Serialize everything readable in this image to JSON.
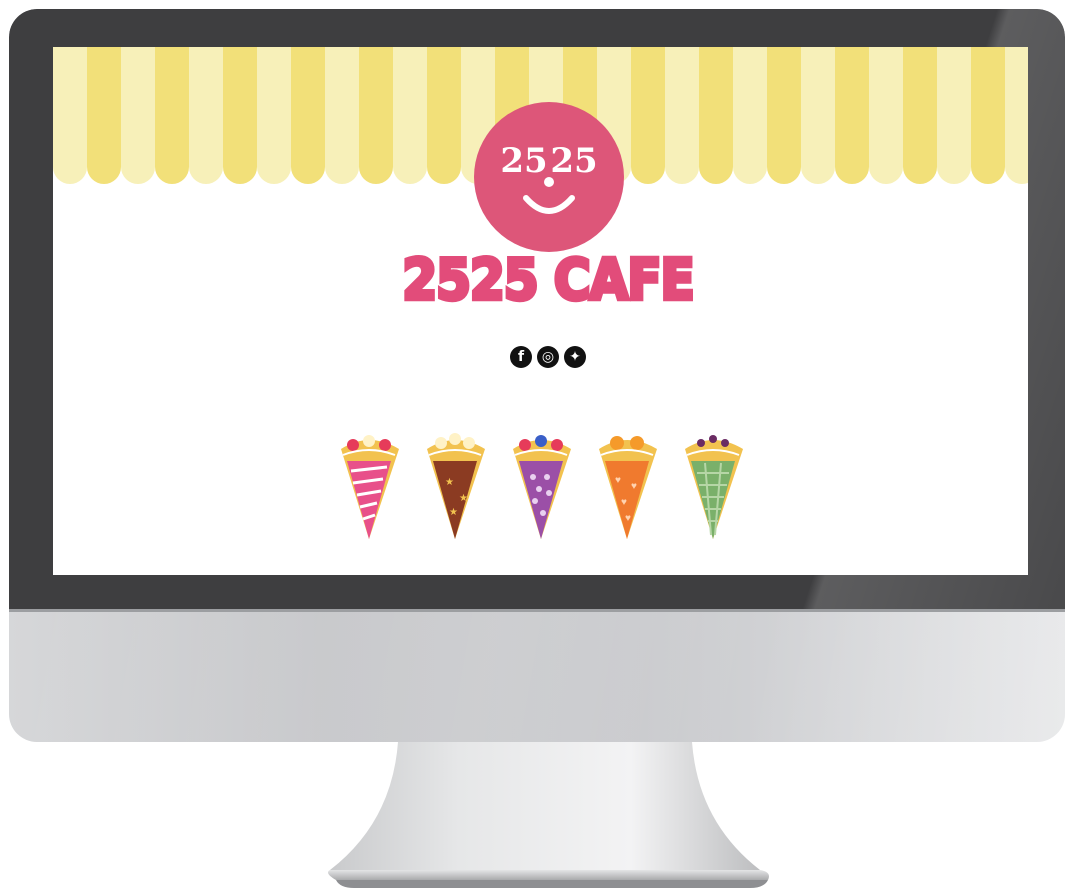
{
  "brand": {
    "name": "2525 CAFE",
    "logo_text": "25 25"
  },
  "colors": {
    "logo_pink": "#dd5679",
    "brand_pink": "#e24c7a",
    "awning_yellow": "#f2e079",
    "awning_light": "#f7f0b9"
  },
  "social": [
    {
      "icon": "facebook-icon",
      "glyph": "f"
    },
    {
      "icon": "instagram-icon",
      "glyph": "◎"
    },
    {
      "icon": "twitter-icon",
      "glyph": "✦"
    }
  ],
  "crepes": [
    {
      "icon": "strawberry-crepe-icon",
      "wrap_color": "#e8508a"
    },
    {
      "icon": "chocolate-crepe-icon",
      "wrap_color": "#8b3b22"
    },
    {
      "icon": "berry-crepe-icon",
      "wrap_color": "#9b4fa7"
    },
    {
      "icon": "orange-crepe-icon",
      "wrap_color": "#f07a2e"
    },
    {
      "icon": "matcha-crepe-icon",
      "wrap_color": "#7ab06a"
    }
  ]
}
